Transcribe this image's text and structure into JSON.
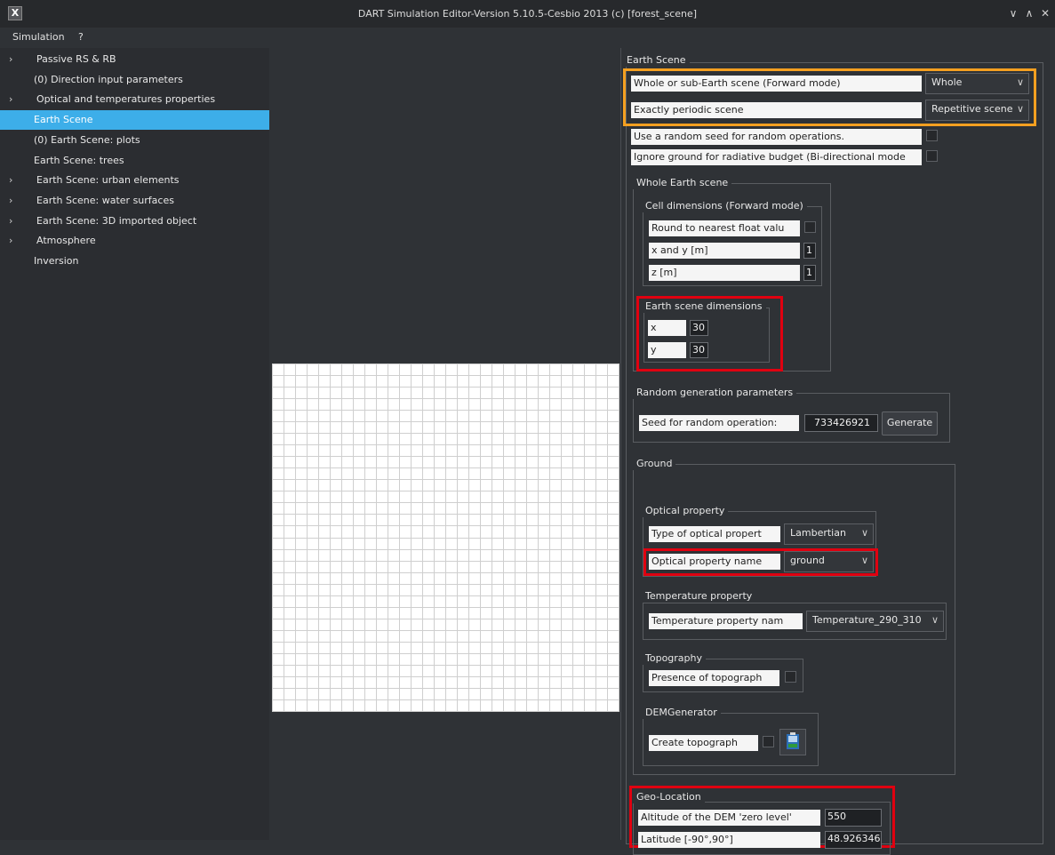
{
  "window": {
    "app_icon_glyph": "X",
    "title": "DART Simulation Editor-Version 5.10.5-Cesbio 2013 (c) [forest_scene]",
    "controls": {
      "minimize": "∨",
      "maximize": "∧",
      "close": "✕"
    }
  },
  "menu": {
    "simulation": "Simulation",
    "help": "?"
  },
  "tree": {
    "items": [
      {
        "label": "Passive RS & RB",
        "expandable": true
      },
      {
        "label": "(0) Direction input parameters",
        "expandable": false
      },
      {
        "label": "Optical and temperatures properties",
        "expandable": true
      },
      {
        "label": "Earth Scene",
        "expandable": false,
        "selected": true
      },
      {
        "label": "(0) Earth Scene: plots",
        "expandable": false
      },
      {
        "label": "Earth Scene: trees",
        "expandable": false
      },
      {
        "label": "Earth Scene: urban elements",
        "expandable": true
      },
      {
        "label": "Earth Scene: water surfaces",
        "expandable": true
      },
      {
        "label": "Earth Scene: 3D imported object",
        "expandable": true
      },
      {
        "label": "Atmosphere",
        "expandable": true
      },
      {
        "label": "Inversion",
        "expandable": false
      }
    ],
    "chevron": "›"
  },
  "panel": {
    "title": "Earth Scene",
    "whole_or_sub_label": "Whole or sub-Earth scene (Forward mode)",
    "whole_or_sub_value": "Whole",
    "periodic_label": "Exactly periodic scene",
    "periodic_value": "Repetitive scene",
    "random_seed_label": "Use a random seed for random operations.",
    "ignore_ground_label": "Ignore ground for radiative budget (Bi-directional mode",
    "whole_earth": {
      "title": "Whole Earth scene",
      "cell_dims": {
        "title": "Cell dimensions (Forward mode)",
        "round_label": "Round to nearest float valu",
        "xy_label": "x and y    [m]",
        "xy_value": "1",
        "z_label": "z    [m]",
        "z_value": "1"
      },
      "scene_dims": {
        "title": "Earth scene dimensions",
        "x_label": "x",
        "x_value": "30",
        "y_label": "y",
        "y_value": "30"
      }
    },
    "random_gen": {
      "title": "Random generation parameters",
      "seed_label": "Seed for random operation:",
      "seed_value": "733426921",
      "generate_button": "Generate"
    },
    "ground": {
      "title": "Ground",
      "optical": {
        "title": "Optical property",
        "type_label": "Type of optical propert",
        "type_value": "Lambertian",
        "name_label": "Optical property name",
        "name_value": "ground"
      },
      "temperature": {
        "title": "Temperature property",
        "name_label": "Temperature property nam",
        "name_value": "Temperature_290_310"
      },
      "topography": {
        "title": "Topography",
        "presence_label": "Presence of topograph"
      },
      "dem": {
        "title": "DEMGenerator",
        "create_label": "Create topograph",
        "icon": "dem-generator-icon"
      }
    },
    "geo": {
      "title": "Geo-Location",
      "altitude_label": "Altitude of the DEM 'zero level'",
      "altitude_value": "550",
      "latitude_label": "Latitude    [-90°,90°]",
      "latitude_value": "48.926346"
    }
  },
  "colors": {
    "selection": "#3daee9",
    "highlight_orange": "#f5a020",
    "highlight_red": "#e00010"
  }
}
